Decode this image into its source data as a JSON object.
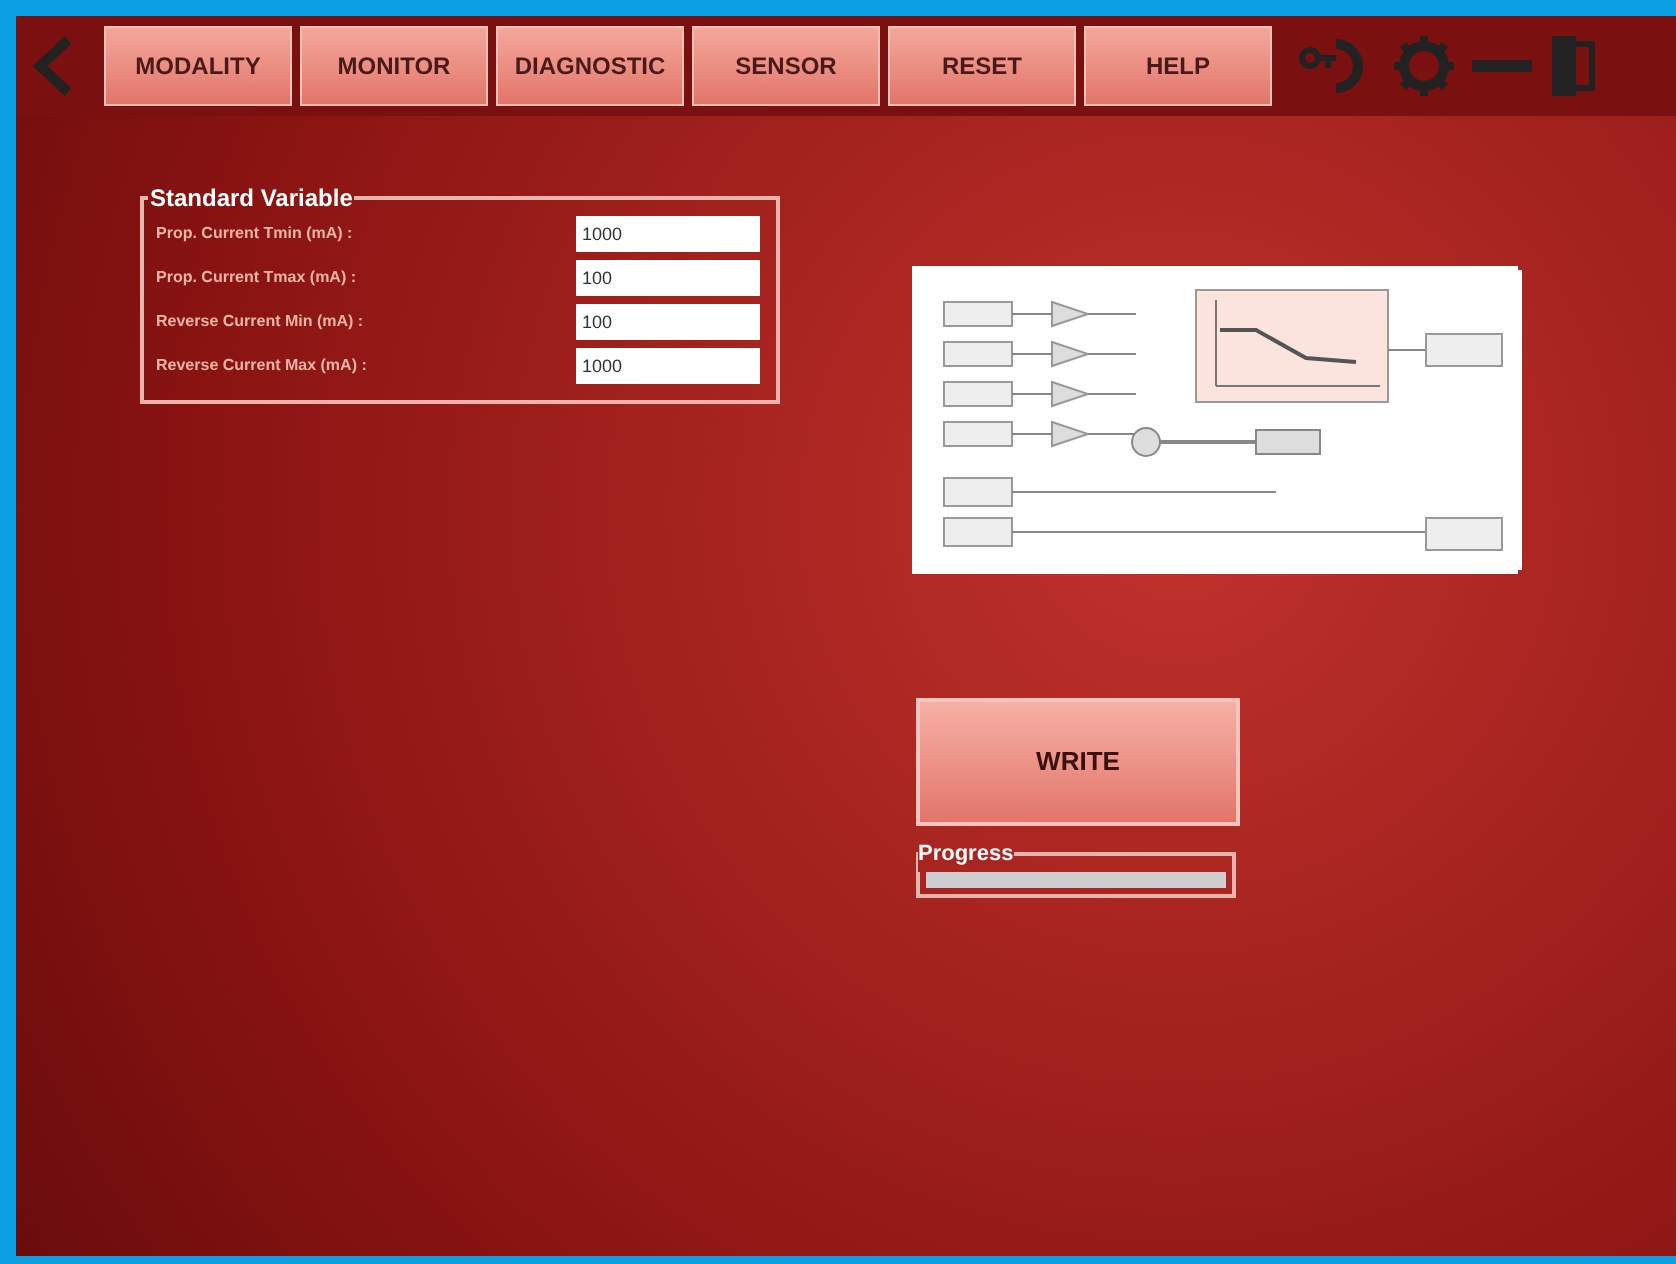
{
  "toolbar": {
    "tabs": [
      {
        "label": "MODALITY"
      },
      {
        "label": "MONITOR"
      },
      {
        "label": "DIAGNOSTIC"
      },
      {
        "label": "SENSOR"
      },
      {
        "label": "RESET"
      },
      {
        "label": "HELP"
      }
    ]
  },
  "standard_variable": {
    "title": "Standard Variable",
    "fields": [
      {
        "label": "Prop. Current Tmin (mA) :",
        "value": "1000"
      },
      {
        "label": "Prop. Current Tmax (mA) :",
        "value": "100"
      },
      {
        "label": "Reverse Current Min (mA) :",
        "value": "100"
      },
      {
        "label": "Reverse Current Max (mA) :",
        "value": "1000"
      }
    ]
  },
  "write_button": {
    "label": "WRITE"
  },
  "progress": {
    "title": "Progress",
    "level": 0
  }
}
